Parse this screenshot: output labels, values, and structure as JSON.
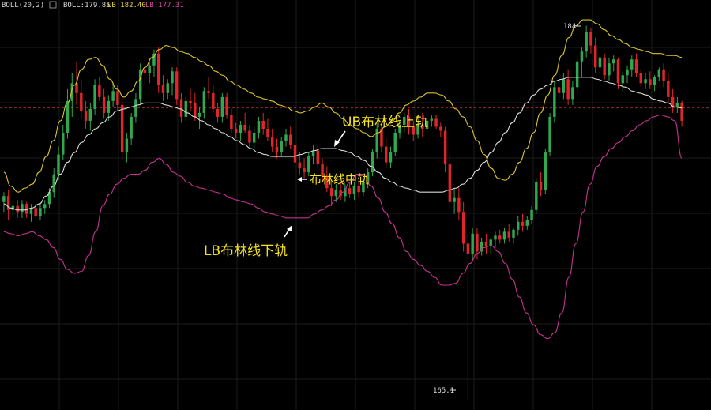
{
  "indicator_header": {
    "name": "BOLL(20,2)",
    "boll_label": "BOLL:179.85",
    "ub_label": "UB:182.40",
    "lb_label": "LB:177.31"
  },
  "annotations": {
    "ub": "UB布林线上轨",
    "mid": "布林线中轨",
    "lb": "LB布林线下轨",
    "high_marker": "184",
    "low_marker": "165.1"
  },
  "colors": {
    "background": "#000000",
    "up_candle": "#2fa84f",
    "down_candle": "#e0262b",
    "ub_line": "#d8c22a",
    "mid_line": "#d8d8d8",
    "lb_line": "#c2328e",
    "annotation_text": "#f5e21c",
    "current_price_line": "#c0392b",
    "grid": "#1c1c1c"
  },
  "chart_data": {
    "type": "candlestick",
    "title": "BOLL(20,2)",
    "ylim": [
      164.6,
      185.3
    ],
    "grid": true,
    "current_price": 179.85,
    "marked_high": 184,
    "marked_low": 165.1,
    "candles": [
      [
        175.1,
        175.6,
        174.6,
        175.4
      ],
      [
        175.4,
        175.7,
        174.2,
        174.7
      ],
      [
        174.7,
        175.2,
        174.4,
        174.9
      ],
      [
        174.9,
        175.2,
        174.3,
        174.6
      ],
      [
        174.6,
        175.2,
        174.3,
        175.0
      ],
      [
        175.0,
        175.1,
        174.3,
        174.5
      ],
      [
        174.5,
        175.0,
        174.1,
        174.8
      ],
      [
        174.8,
        175.0,
        174.3,
        174.4
      ],
      [
        174.4,
        175.0,
        174.2,
        174.8
      ],
      [
        174.8,
        175.2,
        174.5,
        175.0
      ],
      [
        175.0,
        175.8,
        174.8,
        175.6
      ],
      [
        175.6,
        176.8,
        175.3,
        176.5
      ],
      [
        176.5,
        177.9,
        176.2,
        177.5
      ],
      [
        177.5,
        179.0,
        177.2,
        178.6
      ],
      [
        178.6,
        180.8,
        178.3,
        180.2
      ],
      [
        180.2,
        181.6,
        179.4,
        181.1
      ],
      [
        181.1,
        182.2,
        180.0,
        180.6
      ],
      [
        180.6,
        181.3,
        179.3,
        179.7
      ],
      [
        179.7,
        180.2,
        178.8,
        179.2
      ],
      [
        179.2,
        180.1,
        178.7,
        179.8
      ],
      [
        179.8,
        181.3,
        179.5,
        181.0
      ],
      [
        181.0,
        181.4,
        180.2,
        180.4
      ],
      [
        180.4,
        180.8,
        179.3,
        179.6
      ],
      [
        179.6,
        180.5,
        179.2,
        180.2
      ],
      [
        180.2,
        181.1,
        179.9,
        180.7
      ],
      [
        180.7,
        181.0,
        179.7,
        180.0
      ],
      [
        180.0,
        180.4,
        177.2,
        177.6
      ],
      [
        177.6,
        178.6,
        177.1,
        178.3
      ],
      [
        178.3,
        179.6,
        178.0,
        179.4
      ],
      [
        179.4,
        180.6,
        179.1,
        180.3
      ],
      [
        180.3,
        182.1,
        180.0,
        181.8
      ],
      [
        181.8,
        182.6,
        181.0,
        181.6
      ],
      [
        181.6,
        182.2,
        181.1,
        182.0
      ],
      [
        182.0,
        182.8,
        181.4,
        182.6
      ],
      [
        182.6,
        182.9,
        180.6,
        181.0
      ],
      [
        181.0,
        181.5,
        180.2,
        180.6
      ],
      [
        180.6,
        181.3,
        180.3,
        181.1
      ],
      [
        181.1,
        181.9,
        180.5,
        181.7
      ],
      [
        181.7,
        181.9,
        180.0,
        180.3
      ],
      [
        180.3,
        180.6,
        179.1,
        179.4
      ],
      [
        179.4,
        180.4,
        179.2,
        180.2
      ],
      [
        180.2,
        180.8,
        179.7,
        180.1
      ],
      [
        180.1,
        180.6,
        179.2,
        179.4
      ],
      [
        179.4,
        179.9,
        178.8,
        179.6
      ],
      [
        179.6,
        180.9,
        179.3,
        180.7
      ],
      [
        180.7,
        181.4,
        180.3,
        180.6
      ],
      [
        180.6,
        181.0,
        179.6,
        179.8
      ],
      [
        179.8,
        180.1,
        179.1,
        179.4
      ],
      [
        179.4,
        180.6,
        179.1,
        180.4
      ],
      [
        180.4,
        180.6,
        179.3,
        179.5
      ],
      [
        179.5,
        179.8,
        178.6,
        178.8
      ],
      [
        178.8,
        179.1,
        178.3,
        178.6
      ],
      [
        178.6,
        179.2,
        178.2,
        179.0
      ],
      [
        179.0,
        179.6,
        178.6,
        178.7
      ],
      [
        178.7,
        179.0,
        177.9,
        178.1
      ],
      [
        178.1,
        178.9,
        177.8,
        178.6
      ],
      [
        178.6,
        179.4,
        178.3,
        179.2
      ],
      [
        179.2,
        179.6,
        178.5,
        178.8
      ],
      [
        178.8,
        179.3,
        178.2,
        178.4
      ],
      [
        178.4,
        178.8,
        177.6,
        177.9
      ],
      [
        177.9,
        178.3,
        177.3,
        177.6
      ],
      [
        177.6,
        178.4,
        177.4,
        178.2
      ],
      [
        178.2,
        178.8,
        177.9,
        178.5
      ],
      [
        178.5,
        178.9,
        177.8,
        178.0
      ],
      [
        178.0,
        178.3,
        176.9,
        177.1
      ],
      [
        177.1,
        177.6,
        176.5,
        176.8
      ],
      [
        176.8,
        177.3,
        176.3,
        176.6
      ],
      [
        176.6,
        177.6,
        176.4,
        177.4
      ],
      [
        177.4,
        178.0,
        177.0,
        177.7
      ],
      [
        177.7,
        178.0,
        176.8,
        177.0
      ],
      [
        177.0,
        177.3,
        176.1,
        176.4
      ],
      [
        176.4,
        176.9,
        175.6,
        175.8
      ],
      [
        175.8,
        176.2,
        174.9,
        175.4
      ],
      [
        175.4,
        176.0,
        175.1,
        175.7
      ],
      [
        175.7,
        176.1,
        175.2,
        175.4
      ],
      [
        175.4,
        176.0,
        175.1,
        175.8
      ],
      [
        175.8,
        176.1,
        175.3,
        175.5
      ],
      [
        175.5,
        176.1,
        175.2,
        175.9
      ],
      [
        175.9,
        176.2,
        175.3,
        175.6
      ],
      [
        175.6,
        176.3,
        175.4,
        176.1
      ],
      [
        176.1,
        176.8,
        175.8,
        176.6
      ],
      [
        176.6,
        177.8,
        176.4,
        177.6
      ],
      [
        177.6,
        179.1,
        177.3,
        178.8
      ],
      [
        178.8,
        179.1,
        177.6,
        177.9
      ],
      [
        177.9,
        178.3,
        176.8,
        177.1
      ],
      [
        177.1,
        177.9,
        176.8,
        177.6
      ],
      [
        177.6,
        178.8,
        177.4,
        178.6
      ],
      [
        178.6,
        179.2,
        178.3,
        179.0
      ],
      [
        179.0,
        179.6,
        178.6,
        179.4
      ],
      [
        179.4,
        179.8,
        178.5,
        178.9
      ],
      [
        178.9,
        179.2,
        178.2,
        178.5
      ],
      [
        178.5,
        179.2,
        178.3,
        179.0
      ],
      [
        179.0,
        179.6,
        178.4,
        178.8
      ],
      [
        178.8,
        179.4,
        178.6,
        179.2
      ],
      [
        179.2,
        179.5,
        178.9,
        179.3
      ],
      [
        179.3,
        179.5,
        178.8,
        178.9
      ],
      [
        178.9,
        179.1,
        178.4,
        178.7
      ],
      [
        178.7,
        178.9,
        176.6,
        177.0
      ],
      [
        177.0,
        177.5,
        174.8,
        175.1
      ],
      [
        175.1,
        175.8,
        174.5,
        175.3
      ],
      [
        175.3,
        175.8,
        174.2,
        174.6
      ],
      [
        174.6,
        175.1,
        172.6,
        173.0
      ],
      [
        173.0,
        173.5,
        165.1,
        172.5
      ],
      [
        172.5,
        173.8,
        172.2,
        173.5
      ],
      [
        173.5,
        173.8,
        172.2,
        172.6
      ],
      [
        172.6,
        173.3,
        172.4,
        173.1
      ],
      [
        173.1,
        173.5,
        172.5,
        172.9
      ],
      [
        172.9,
        173.3,
        172.5,
        173.2
      ],
      [
        173.2,
        173.6,
        172.8,
        173.4
      ],
      [
        173.4,
        173.7,
        173.0,
        173.2
      ],
      [
        173.2,
        173.8,
        173.0,
        173.6
      ],
      [
        173.6,
        174.0,
        173.1,
        173.3
      ],
      [
        173.3,
        173.8,
        173.0,
        173.7
      ],
      [
        173.7,
        174.4,
        173.4,
        174.1
      ],
      [
        174.1,
        174.5,
        173.6,
        173.9
      ],
      [
        173.9,
        174.4,
        173.7,
        174.2
      ],
      [
        174.2,
        174.9,
        174.0,
        174.7
      ],
      [
        174.7,
        176.3,
        174.5,
        176.1
      ],
      [
        176.1,
        176.6,
        175.4,
        175.7
      ],
      [
        175.7,
        177.8,
        175.5,
        177.6
      ],
      [
        177.6,
        179.6,
        177.4,
        179.4
      ],
      [
        179.4,
        181.2,
        179.1,
        180.9
      ],
      [
        180.9,
        181.8,
        180.2,
        180.6
      ],
      [
        180.6,
        181.6,
        180.3,
        181.3
      ],
      [
        181.3,
        181.8,
        180.0,
        180.3
      ],
      [
        180.3,
        181.2,
        180.0,
        180.9
      ],
      [
        180.9,
        182.4,
        180.6,
        182.2
      ],
      [
        182.2,
        182.9,
        181.4,
        182.7
      ],
      [
        182.7,
        184.0,
        182.4,
        183.7
      ],
      [
        183.7,
        183.9,
        182.6,
        183.0
      ],
      [
        183.0,
        183.4,
        181.6,
        181.9
      ],
      [
        181.9,
        182.6,
        181.6,
        182.4
      ],
      [
        182.4,
        182.6,
        181.3,
        181.5
      ],
      [
        181.5,
        182.4,
        181.2,
        182.1
      ],
      [
        182.1,
        182.5,
        181.7,
        182.3
      ],
      [
        182.3,
        182.4,
        180.8,
        181.1
      ],
      [
        181.1,
        181.7,
        180.7,
        181.5
      ],
      [
        181.5,
        182.0,
        181.1,
        181.8
      ],
      [
        181.8,
        182.5,
        181.4,
        182.3
      ],
      [
        182.3,
        182.6,
        181.4,
        181.6
      ],
      [
        181.6,
        181.8,
        180.9,
        181.1
      ],
      [
        181.1,
        181.6,
        180.8,
        181.3
      ],
      [
        181.3,
        181.7,
        180.8,
        181.0
      ],
      [
        181.0,
        181.5,
        180.7,
        181.4
      ],
      [
        181.4,
        181.9,
        181.2,
        181.8
      ],
      [
        181.8,
        182.1,
        180.9,
        181.2
      ],
      [
        181.2,
        181.6,
        180.1,
        180.4
      ],
      [
        180.4,
        180.8,
        179.6,
        179.9
      ],
      [
        179.9,
        180.4,
        179.6,
        180.1
      ],
      [
        180.1,
        180.2,
        178.9,
        179.2
      ]
    ],
    "ub": [
      176.6,
      175.9,
      175.6,
      175.8,
      176.0,
      176.6,
      177.4,
      178.2,
      179.2,
      180.1,
      181.0,
      181.8,
      182.3,
      182.4,
      182.0,
      181.3,
      180.8,
      180.4,
      180.7,
      181.2,
      181.9,
      182.4,
      182.8,
      183.0,
      182.9,
      182.7,
      182.6,
      182.4,
      182.2,
      182.0,
      181.7,
      181.5,
      181.2,
      181.0,
      180.8,
      180.6,
      180.4,
      180.3,
      180.2,
      180.0,
      179.9,
      179.7,
      179.6,
      179.7,
      179.9,
      180.1,
      179.9,
      179.6,
      179.3,
      179.0,
      178.8,
      178.6,
      178.4,
      178.6,
      178.9,
      179.2,
      179.6,
      180.0,
      180.2,
      180.4,
      180.6,
      180.6,
      180.5,
      180.2,
      179.8,
      179.4,
      178.9,
      178.2,
      177.5,
      176.8,
      176.3,
      176.2,
      176.5,
      177.1,
      177.8,
      178.6,
      179.6,
      180.5,
      181.5,
      182.5,
      183.4,
      184.0,
      184.3,
      184.3,
      184.1,
      183.8,
      183.5,
      183.3,
      183.1,
      182.9,
      182.8,
      182.7,
      182.6,
      182.6,
      182.5,
      182.5,
      182.4
    ],
    "mid": [
      175.0,
      174.8,
      174.7,
      174.7,
      174.8,
      175.0,
      175.4,
      175.9,
      176.5,
      177.1,
      177.6,
      178.1,
      178.5,
      178.8,
      179.1,
      179.4,
      179.7,
      179.8,
      179.9,
      180.0,
      180.1,
      180.1,
      180.1,
      180.0,
      179.9,
      179.8,
      179.6,
      179.4,
      179.2,
      179.0,
      178.8,
      178.6,
      178.4,
      178.2,
      178.0,
      177.8,
      177.6,
      177.5,
      177.4,
      177.4,
      177.4,
      177.4,
      177.5,
      177.6,
      177.7,
      177.8,
      177.8,
      177.8,
      177.7,
      177.6,
      177.4,
      177.2,
      176.9,
      176.6,
      176.3,
      176.1,
      175.9,
      175.8,
      175.7,
      175.6,
      175.6,
      175.6,
      175.6,
      175.7,
      175.8,
      176.0,
      176.3,
      176.7,
      177.1,
      177.6,
      178.1,
      178.6,
      179.1,
      179.6,
      180.1,
      180.5,
      180.8,
      181.0,
      181.2,
      181.3,
      181.4,
      181.4,
      181.4,
      181.4,
      181.3,
      181.2,
      181.1,
      181.0,
      180.9,
      180.7,
      180.6,
      180.5,
      180.3,
      180.2,
      180.1,
      179.9,
      179.85
    ],
    "lb": [
      173.6,
      173.5,
      173.4,
      173.5,
      173.6,
      173.4,
      173.2,
      172.8,
      172.2,
      171.7,
      171.5,
      171.6,
      172.4,
      173.6,
      174.9,
      175.5,
      176.0,
      176.3,
      176.5,
      176.5,
      176.7,
      177.1,
      177.3,
      177.0,
      176.6,
      176.4,
      176.1,
      175.9,
      175.8,
      175.7,
      175.6,
      175.5,
      175.3,
      175.2,
      175.1,
      175.0,
      174.8,
      174.6,
      174.5,
      174.4,
      174.3,
      174.3,
      174.3,
      174.3,
      174.5,
      174.7,
      174.9,
      175.2,
      175.6,
      176.1,
      176.5,
      176.5,
      175.9,
      175.3,
      174.6,
      174.0,
      173.3,
      172.6,
      172.2,
      171.9,
      171.6,
      171.3,
      170.9,
      170.9,
      171.0,
      171.5,
      172.0,
      172.5,
      172.8,
      172.9,
      172.6,
      172.0,
      171.2,
      170.3,
      169.5,
      168.9,
      168.4,
      168.2,
      168.5,
      169.5,
      171.3,
      173.0,
      174.6,
      176.0,
      176.9,
      177.4,
      177.8,
      178.1,
      178.4,
      178.7,
      179.0,
      179.2,
      179.4,
      179.5,
      179.4,
      179.2,
      177.31
    ]
  }
}
